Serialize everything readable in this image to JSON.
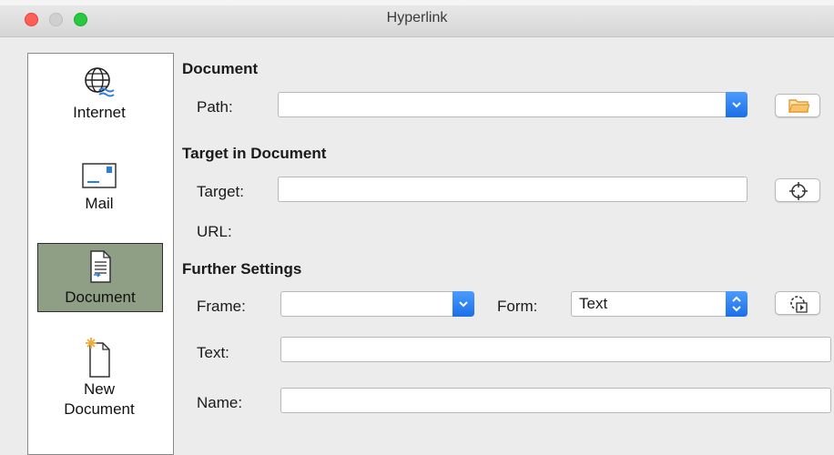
{
  "window": {
    "title": "Hyperlink"
  },
  "sidebar": {
    "items": [
      {
        "label": "Internet",
        "icon": "globe-icon",
        "selected": false
      },
      {
        "label": "Mail",
        "icon": "envelope-icon",
        "selected": false
      },
      {
        "label": "Document",
        "icon": "document-icon",
        "selected": true
      },
      {
        "label": "New Document",
        "label_line1": "New",
        "label_line2": "Document",
        "icon": "new-document-icon",
        "selected": false
      }
    ]
  },
  "document_section": {
    "heading": "Document",
    "path_label": "Path:",
    "path_value": ""
  },
  "target_section": {
    "heading": "Target in Document",
    "target_label": "Target:",
    "target_value": "",
    "url_label": "URL:"
  },
  "further_settings": {
    "heading": "Further Settings",
    "frame_label": "Frame:",
    "frame_value": "",
    "form_label": "Form:",
    "form_value": "Text",
    "text_label": "Text:",
    "text_value": "",
    "name_label": "Name:",
    "name_value": ""
  },
  "colors": {
    "accent": "#1b6fe8",
    "selected_item": "#8f9f86",
    "folder": "#f0a93a"
  }
}
